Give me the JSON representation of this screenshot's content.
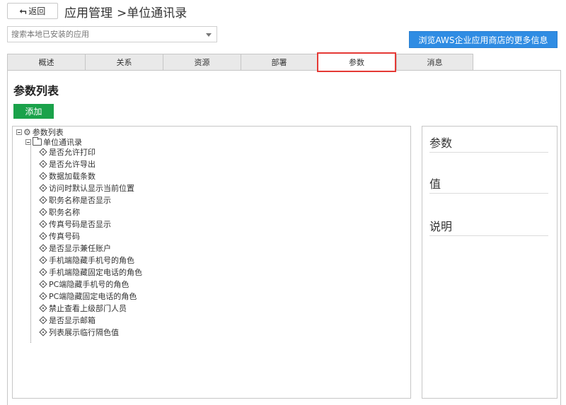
{
  "header": {
    "back_label": "返回",
    "breadcrumb": [
      "应用管理",
      ">单位通讯录"
    ]
  },
  "search": {
    "placeholder": "搜索本地已安装的应用"
  },
  "store_button": "浏览AWS企业应用商店的更多信息",
  "tabs": [
    {
      "label": "概述"
    },
    {
      "label": "关系"
    },
    {
      "label": "资源"
    },
    {
      "label": "部署"
    },
    {
      "label": "参数"
    },
    {
      "label": "消息"
    }
  ],
  "active_tab": "参数",
  "panel": {
    "title": "参数列表",
    "add_label": "添加"
  },
  "tree": {
    "root": "参数列表",
    "group": "单位通讯录",
    "items": [
      "是否允许打印",
      "是否允许导出",
      "数据加载条数",
      "访问时默认显示当前位置",
      "职务名称是否显示",
      "职务名称",
      "传真号码是否显示",
      "传真号码",
      "是否显示兼任账户",
      "手机端隐藏手机号的角色",
      "手机端隐藏固定电话的角色",
      "PC端隐藏手机号的角色",
      "PC端隐藏固定电话的角色",
      "禁止查看上级部门人员",
      "是否显示邮箱",
      "列表展示临行隔色值"
    ]
  },
  "detail": {
    "param_label": "参数",
    "value_label": "值",
    "desc_label": "说明"
  },
  "colors": {
    "accent": "#2f8ce3",
    "add": "#1aa24a",
    "highlight": "#e53935"
  }
}
